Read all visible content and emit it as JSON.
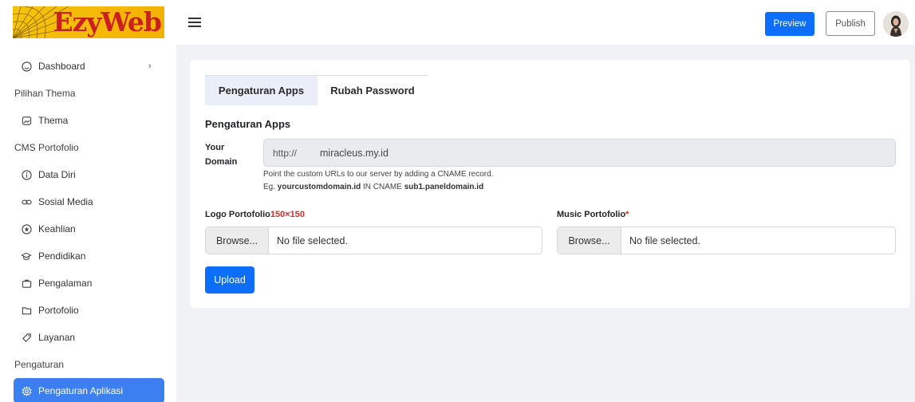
{
  "brand": {
    "name": "EzyWeb"
  },
  "sidebar": {
    "items": [
      {
        "type": "item",
        "label": "Dashboard",
        "icon": "dashboard-icon",
        "has_chevron": true,
        "chevron": "›"
      },
      {
        "type": "header",
        "label": "Pilihan Thema"
      },
      {
        "type": "item",
        "label": "Thema",
        "icon": "theme-icon"
      },
      {
        "type": "header",
        "label": "CMS Portofolio"
      },
      {
        "type": "item",
        "label": "Data Diri",
        "icon": "info-icon"
      },
      {
        "type": "item",
        "label": "Sosial Media",
        "icon": "link-icon"
      },
      {
        "type": "item",
        "label": "Keahlian",
        "icon": "star-icon"
      },
      {
        "type": "item",
        "label": "Pendidikan",
        "icon": "graduation-cap-icon"
      },
      {
        "type": "item",
        "label": "Pengalaman",
        "icon": "briefcase-icon"
      },
      {
        "type": "item",
        "label": "Portofolio",
        "icon": "folder-icon"
      },
      {
        "type": "item",
        "label": "Layanan",
        "icon": "tag-icon"
      },
      {
        "type": "header",
        "label": "Pengaturan"
      },
      {
        "type": "item",
        "label": "Pengaturan Aplikasi",
        "icon": "gear-icon",
        "active": true
      }
    ]
  },
  "topbar": {
    "preview_label": "Preview",
    "publish_label": "Publish"
  },
  "main": {
    "tabs": [
      {
        "label": "Pengaturan Apps",
        "active": true
      },
      {
        "label": "Rubah Password",
        "active": false
      }
    ],
    "section_title": "Pengaturan Apps",
    "domain": {
      "label_line1": "Your",
      "label_line2": "Domain",
      "prefix": "http://",
      "value": "miracleus.my.id",
      "hint_line1": "Point the custom URLs to our server by adding a CNAME record.",
      "hint_eg": "Eg.",
      "hint_custom": "yourcustomdomain.id",
      "hint_in_cname": "IN CNAME",
      "hint_target": "sub1.paneldomain.id"
    },
    "logo": {
      "label": "Logo Portofolio",
      "size_note": "150×150",
      "browse_label": "Browse...",
      "file_text": "No file selected."
    },
    "music": {
      "label": "Music Portofolio",
      "required_mark": "*",
      "browse_label": "Browse...",
      "file_text": "No file selected."
    },
    "upload_label": "Upload"
  },
  "colors": {
    "primary": "#0d6efd",
    "sidebar_active": "#3b7ff0",
    "logo_yellow": "#f5c30b",
    "logo_red": "#cc1f1f",
    "required_red": "#d62b2b"
  }
}
